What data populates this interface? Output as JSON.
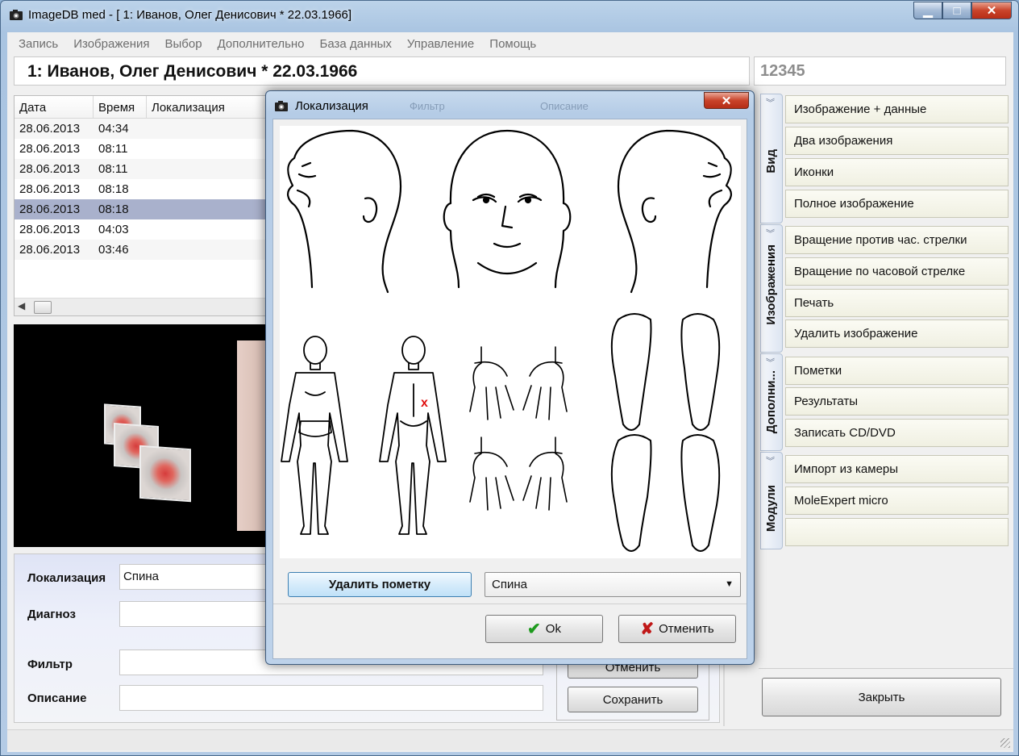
{
  "window": {
    "title": "ImageDB med - [  1: Иванов, Олег Денисович   * 22.03.1966]",
    "minimize": "▁",
    "maximize": "□",
    "close": "✕"
  },
  "menu": [
    "Запись",
    "Изображения",
    "Выбор",
    "Дополнительно",
    "База данных",
    "Управление",
    "Помощь"
  ],
  "patient": {
    "name": "1: Иванов, Олег Денисович   * 22.03.1966",
    "id": "12345"
  },
  "table": {
    "headers": [
      "Дата",
      "Время",
      "Локализация"
    ],
    "rows": [
      {
        "date": "28.06.2013",
        "time": "04:34"
      },
      {
        "date": "28.06.2013",
        "time": "08:11"
      },
      {
        "date": "28.06.2013",
        "time": "08:11"
      },
      {
        "date": "28.06.2013",
        "time": "08:18"
      },
      {
        "date": "28.06.2013",
        "time": "08:18"
      },
      {
        "date": "28.06.2013",
        "time": "04:03"
      },
      {
        "date": "28.06.2013",
        "time": "03:46"
      }
    ],
    "selected_row": 4
  },
  "form": {
    "localization_label": "Локализация",
    "localization_value": "Спина",
    "diagnosis_label": "Диагноз",
    "filter_label": "Фильтр",
    "description_label": "Описание",
    "cancel_label": "Отменить",
    "save_label": "Сохранить"
  },
  "side_tabs": [
    "Вид",
    "Изображения",
    "Дополни...",
    "Модули"
  ],
  "side_buttons": {
    "view": [
      "Изображение + данные",
      "Два изображения",
      "Иконки",
      "Полное изображение"
    ],
    "images": [
      "Вращение против час. стрелки",
      "Вращение по часовой стрелке",
      "Печать",
      "Удалить изображение"
    ],
    "extra": [
      "Пометки",
      "Результаты",
      "Записать CD/DVD"
    ],
    "modules": [
      "Импорт из камеры",
      "MoleExpert micro",
      ""
    ]
  },
  "close_button": "Закрыть",
  "dialog": {
    "title": "Локализация",
    "close": "✕",
    "delete_mark": "Удалить пометку",
    "selected_region": "Спина",
    "ok": "Ok",
    "cancel": "Отменить",
    "mark_symbol": "x",
    "behind_header": {
      "filter": "Фильтр",
      "description": "Описание"
    }
  },
  "colors": {
    "selected_row": "#a9b1cc",
    "mark": "#e01010",
    "ok_check": "#1d9a1d",
    "cancel_x": "#c01818"
  }
}
